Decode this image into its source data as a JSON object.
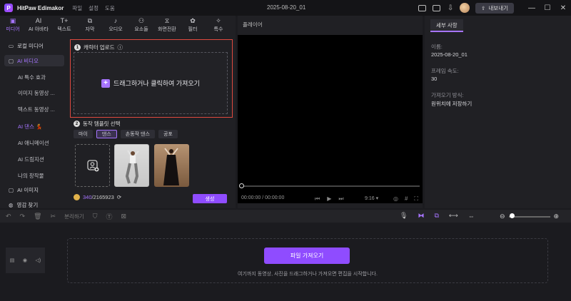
{
  "titlebar": {
    "app_name": "HitPaw Edimakor",
    "menu": [
      "파일",
      "설정",
      "도움"
    ],
    "doc_title": "2025-08-20_01",
    "export_label": "내보내기"
  },
  "tabs": [
    {
      "icon": "▣",
      "label": "미디어"
    },
    {
      "icon": "AI",
      "label": "AI 아바타"
    },
    {
      "icon": "T+",
      "label": "텍스트"
    },
    {
      "icon": "⧉",
      "label": "자막"
    },
    {
      "icon": "♪",
      "label": "오디오"
    },
    {
      "icon": "⚇",
      "label": "요소들"
    },
    {
      "icon": "⧖",
      "label": "화면전환"
    },
    {
      "icon": "✿",
      "label": "필터"
    },
    {
      "icon": "✧",
      "label": "특수"
    }
  ],
  "nav": {
    "local_media": "로컬 미디어",
    "ai_video": "AI 비디오",
    "sub": [
      "AI 특수 효과",
      "이미지 동영상 ...",
      "텍스트 동영상 ...",
      "AI 댄스 💃",
      "AI 애니메이션",
      "AI 드림지션",
      "나의 창작물"
    ],
    "ai_image": "AI 이미지",
    "stock": "영감 찾기"
  },
  "upload": {
    "step": "1",
    "title": "캐릭터 업로드",
    "dropzone_text": "드래그하거나 클릭하여 가져오기"
  },
  "template": {
    "step": "2",
    "title": "동작 템플릿 선택",
    "chips": [
      "마이",
      "댄스",
      "손동작 댄스",
      "공포"
    ],
    "selected_chip": 1
  },
  "credits": {
    "current": "340",
    "total": "/2165923",
    "generate_label": "생성"
  },
  "player": {
    "title": "플레이어",
    "time": "00:00:00 / 00:00:00",
    "ratio": "9:16 ▾"
  },
  "details": {
    "tab": "세부 사항",
    "name_label": "이름:",
    "name_value": "2025-08-20_01",
    "fps_label": "프레임 속도:",
    "fps_value": "30",
    "save_label": "가져오기 방식:",
    "save_value": "원위치에 저장하기"
  },
  "toolbar": {
    "split_label": "분리하기"
  },
  "timeline": {
    "import_label": "파일 가져오기",
    "hint": "여기까지 동영상, 사진을 드래그하거나 가져오면 편집을 시작합니다."
  },
  "colors": {
    "accent": "#a674ff",
    "button": "#8f4cff",
    "highlight_border": "#e04a3f"
  }
}
